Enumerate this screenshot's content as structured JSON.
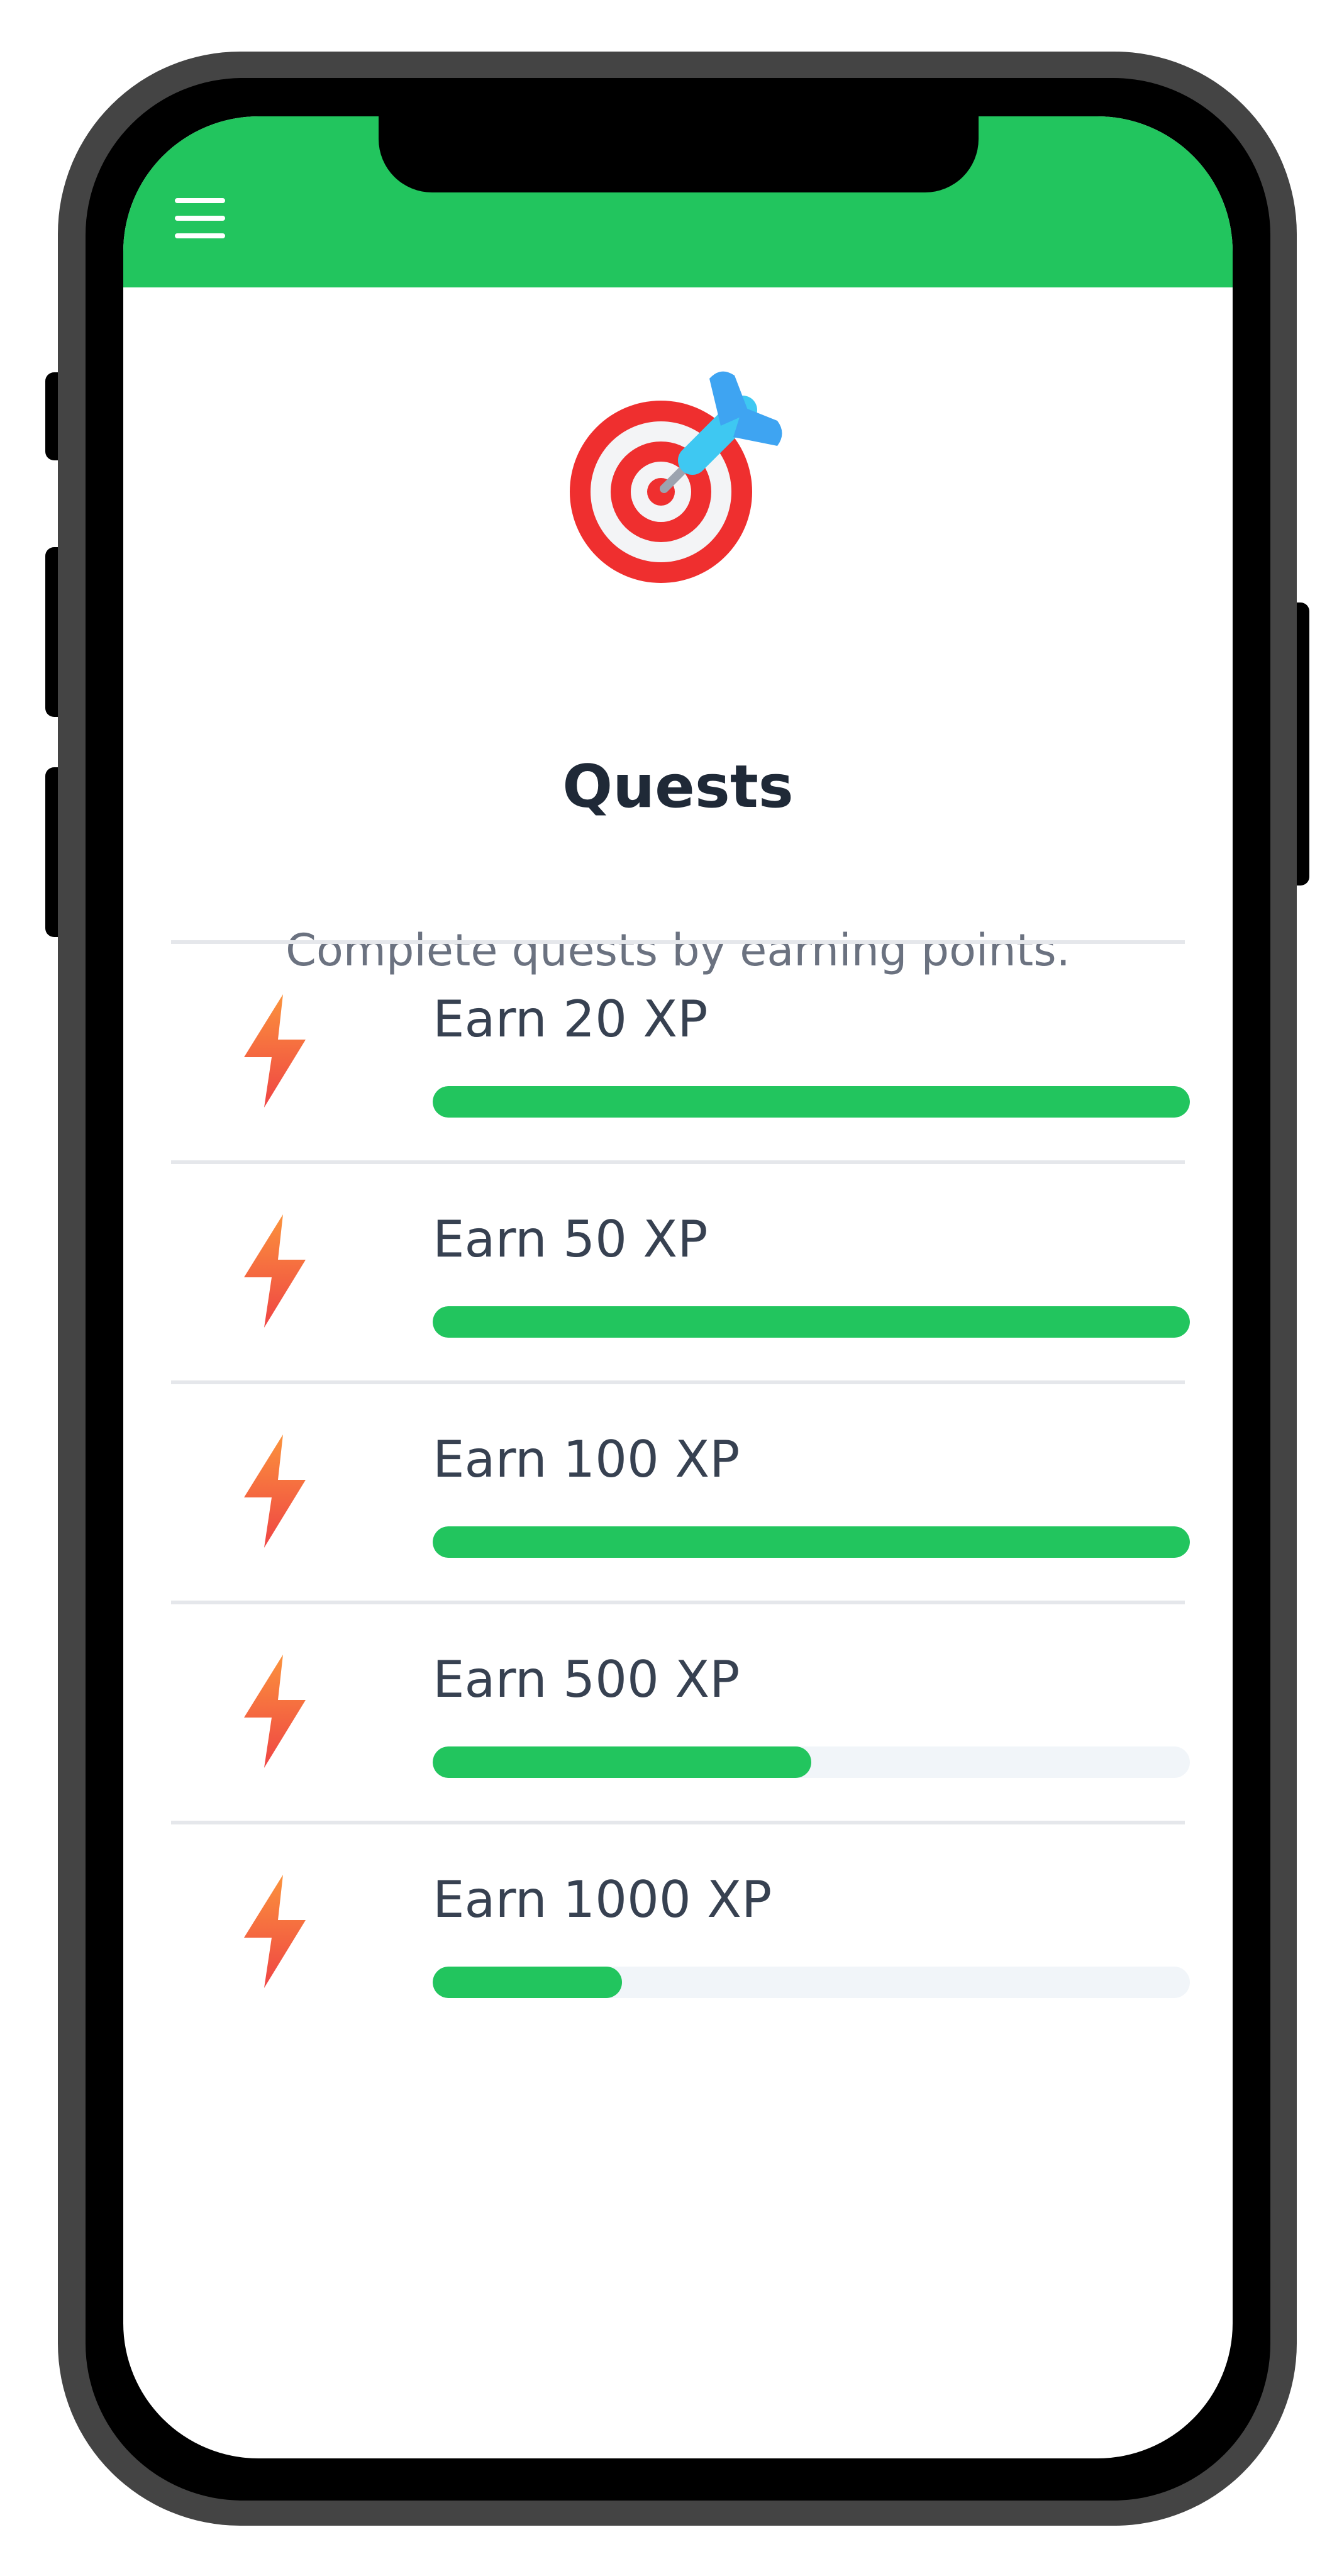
{
  "colors": {
    "accent": "#22c55e",
    "frame": "#444444",
    "track": "#f1f5f9"
  },
  "header": {
    "menu_icon": "hamburger-menu-icon"
  },
  "hero": {
    "icon": "target-with-dart-icon",
    "title": "Quests",
    "subtitle": "Complete quests by earning points."
  },
  "quests": [
    {
      "label": "Earn 20 XP",
      "icon": "lightning-bolt-icon",
      "progress": 1.0
    },
    {
      "label": "Earn 50 XP",
      "icon": "lightning-bolt-icon",
      "progress": 1.0
    },
    {
      "label": "Earn 100 XP",
      "icon": "lightning-bolt-icon",
      "progress": 1.0
    },
    {
      "label": "Earn 500 XP",
      "icon": "lightning-bolt-icon",
      "progress": 0.5
    },
    {
      "label": "Earn 1000 XP",
      "icon": "lightning-bolt-icon",
      "progress": 0.25
    }
  ]
}
